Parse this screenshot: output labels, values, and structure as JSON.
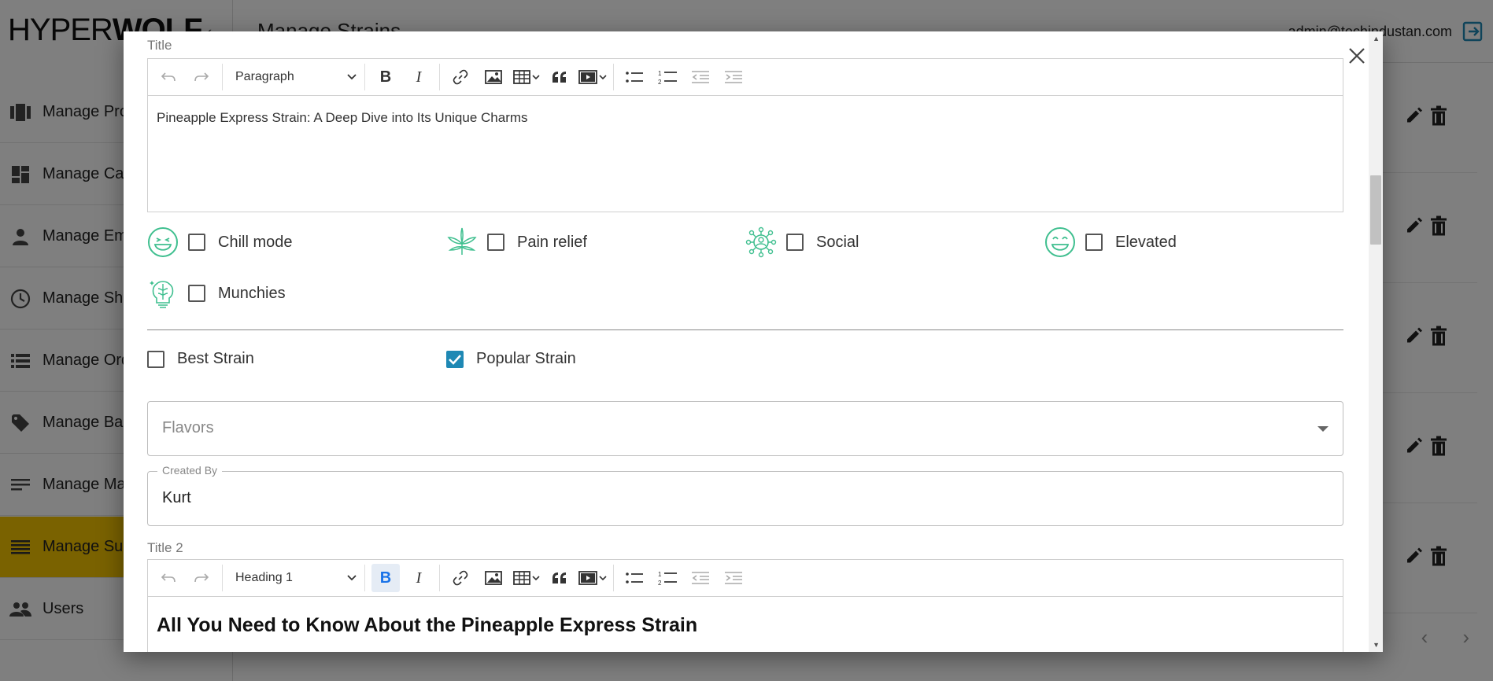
{
  "app": {
    "logo_thin": "HYPER",
    "logo_bold": "WOLF",
    "page_title": "Manage Strains",
    "admin_email": "admin@techindustan.com"
  },
  "sidebar": {
    "items": [
      {
        "label": "Manage Products",
        "icon": "products-icon"
      },
      {
        "label": "Manage Categories",
        "icon": "dashboard-icon"
      },
      {
        "label": "Manage Employees",
        "icon": "person-icon"
      },
      {
        "label": "Manage Shop Timings",
        "icon": "clock-icon"
      },
      {
        "label": "Manage Orders",
        "icon": "list-icon"
      },
      {
        "label": "Manage Banners",
        "icon": "tag-icon"
      },
      {
        "label": "Manage Main Strains",
        "icon": "notes-icon"
      },
      {
        "label": "Manage Sub Strains",
        "icon": "menu-icon",
        "active": true
      },
      {
        "label": "Users",
        "icon": "users-icon"
      }
    ]
  },
  "modal": {
    "title_label": "Title",
    "editor1": {
      "block_format": "Paragraph",
      "content": "Pineapple Express Strain: A Deep Dive into Its Unique Charms"
    },
    "moods": [
      {
        "label": "Chill mode",
        "icon": "smile-face-icon",
        "checked": false
      },
      {
        "label": "Pain relief",
        "icon": "leaf-icon",
        "checked": false
      },
      {
        "label": "Social",
        "icon": "social-network-icon",
        "checked": false
      },
      {
        "label": "Elevated",
        "icon": "grin-face-icon",
        "checked": false
      },
      {
        "label": "Munchies",
        "icon": "brain-bulb-icon",
        "checked": false
      }
    ],
    "best_strain": {
      "label": "Best Strain",
      "checked": false
    },
    "popular_strain": {
      "label": "Popular Strain",
      "checked": true
    },
    "flavors": {
      "placeholder": "Flavors"
    },
    "created_by": {
      "label": "Created By",
      "value": "Kurt"
    },
    "title2_label": "Title 2",
    "editor2": {
      "block_format": "Heading 1",
      "content": "All You Need to Know About the Pineapple Express Strain"
    }
  },
  "colors": {
    "accent": "#1e88b4",
    "icon_green": "#3fbf8f",
    "active_nav": "#f5c400"
  }
}
